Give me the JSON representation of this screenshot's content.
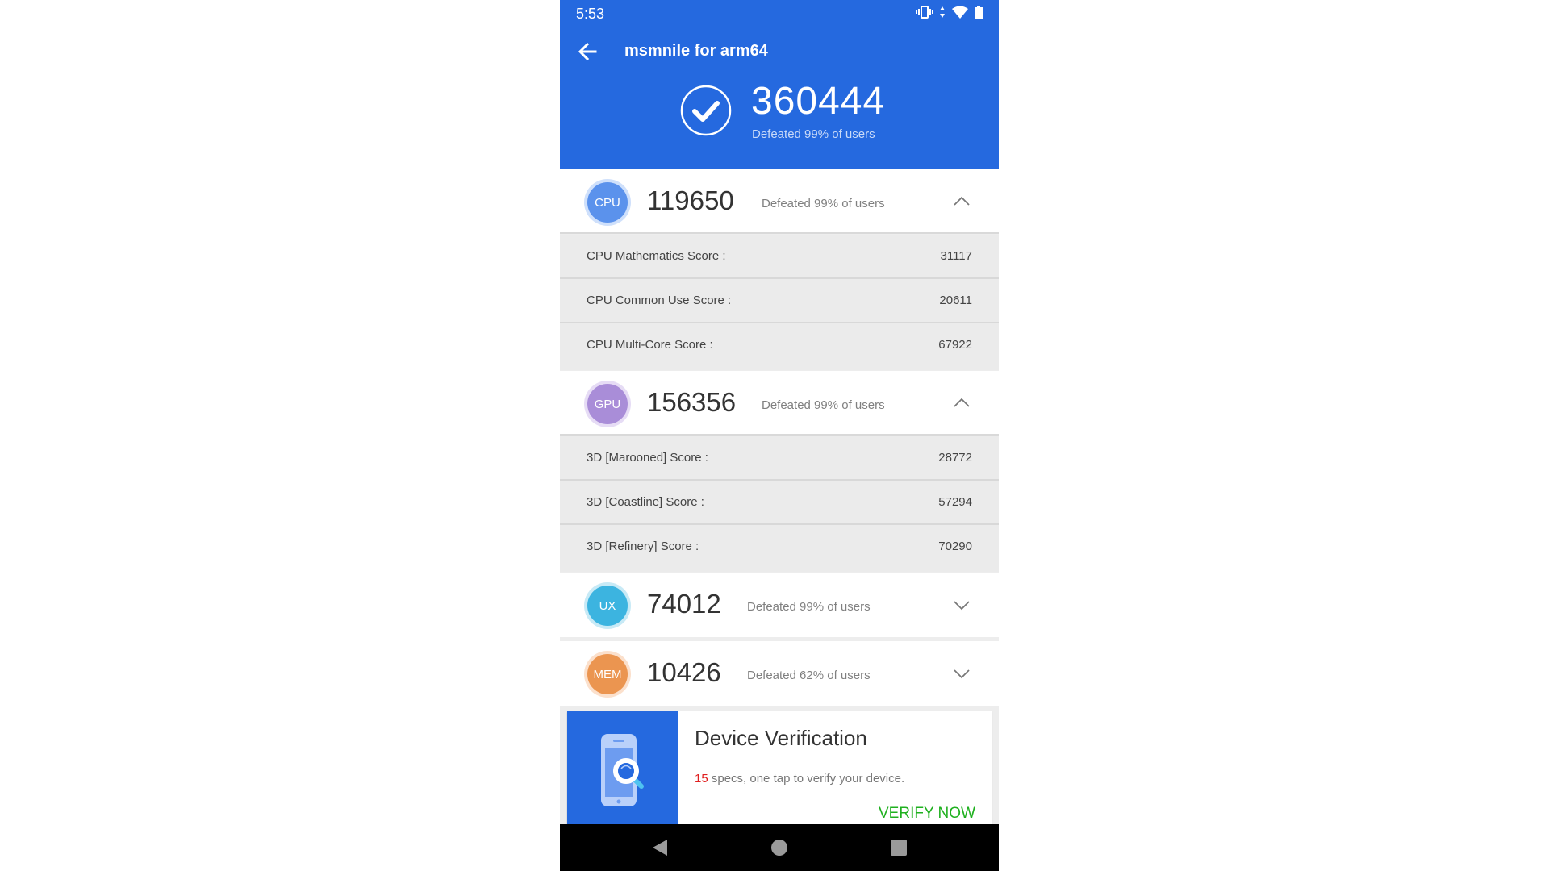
{
  "status_bar": {
    "time": "5:53",
    "icons": [
      "vibrate-icon",
      "data-arrows-icon",
      "wifi-icon",
      "battery-icon"
    ]
  },
  "header": {
    "title": "msmnile for arm64",
    "total_score": "360444",
    "total_subtitle": "Defeated 99% of users",
    "accent_color": "#2569df"
  },
  "categories": [
    {
      "badge": "CPU",
      "score": "119650",
      "subtitle": "Defeated 99% of users",
      "expanded": true,
      "color": "#5b92ec",
      "rows": [
        {
          "label": "CPU Mathematics Score :",
          "value": "31117"
        },
        {
          "label": "CPU Common Use Score :",
          "value": "20611"
        },
        {
          "label": "CPU Multi-Core Score :",
          "value": "67922"
        }
      ]
    },
    {
      "badge": "GPU",
      "score": "156356",
      "subtitle": "Defeated 99% of users",
      "expanded": true,
      "color": "#a98dd8",
      "rows": [
        {
          "label": "3D [Marooned] Score :",
          "value": "28772"
        },
        {
          "label": "3D [Coastline] Score :",
          "value": "57294"
        },
        {
          "label": "3D [Refinery] Score :",
          "value": "70290"
        }
      ]
    },
    {
      "badge": "UX",
      "score": "74012",
      "subtitle": "Defeated 99% of users",
      "expanded": false,
      "color": "#3cb4e0",
      "rows": []
    },
    {
      "badge": "MEM",
      "score": "10426",
      "subtitle": "Defeated 62% of users",
      "expanded": false,
      "color": "#eb9550",
      "rows": []
    }
  ],
  "promo_card": {
    "title": "Device Verification",
    "spec_count": "15",
    "description": " specs, one tap to verify your device.",
    "cta": "VERIFY NOW"
  },
  "nav_bar": {
    "buttons": [
      "back",
      "home",
      "recents"
    ]
  }
}
